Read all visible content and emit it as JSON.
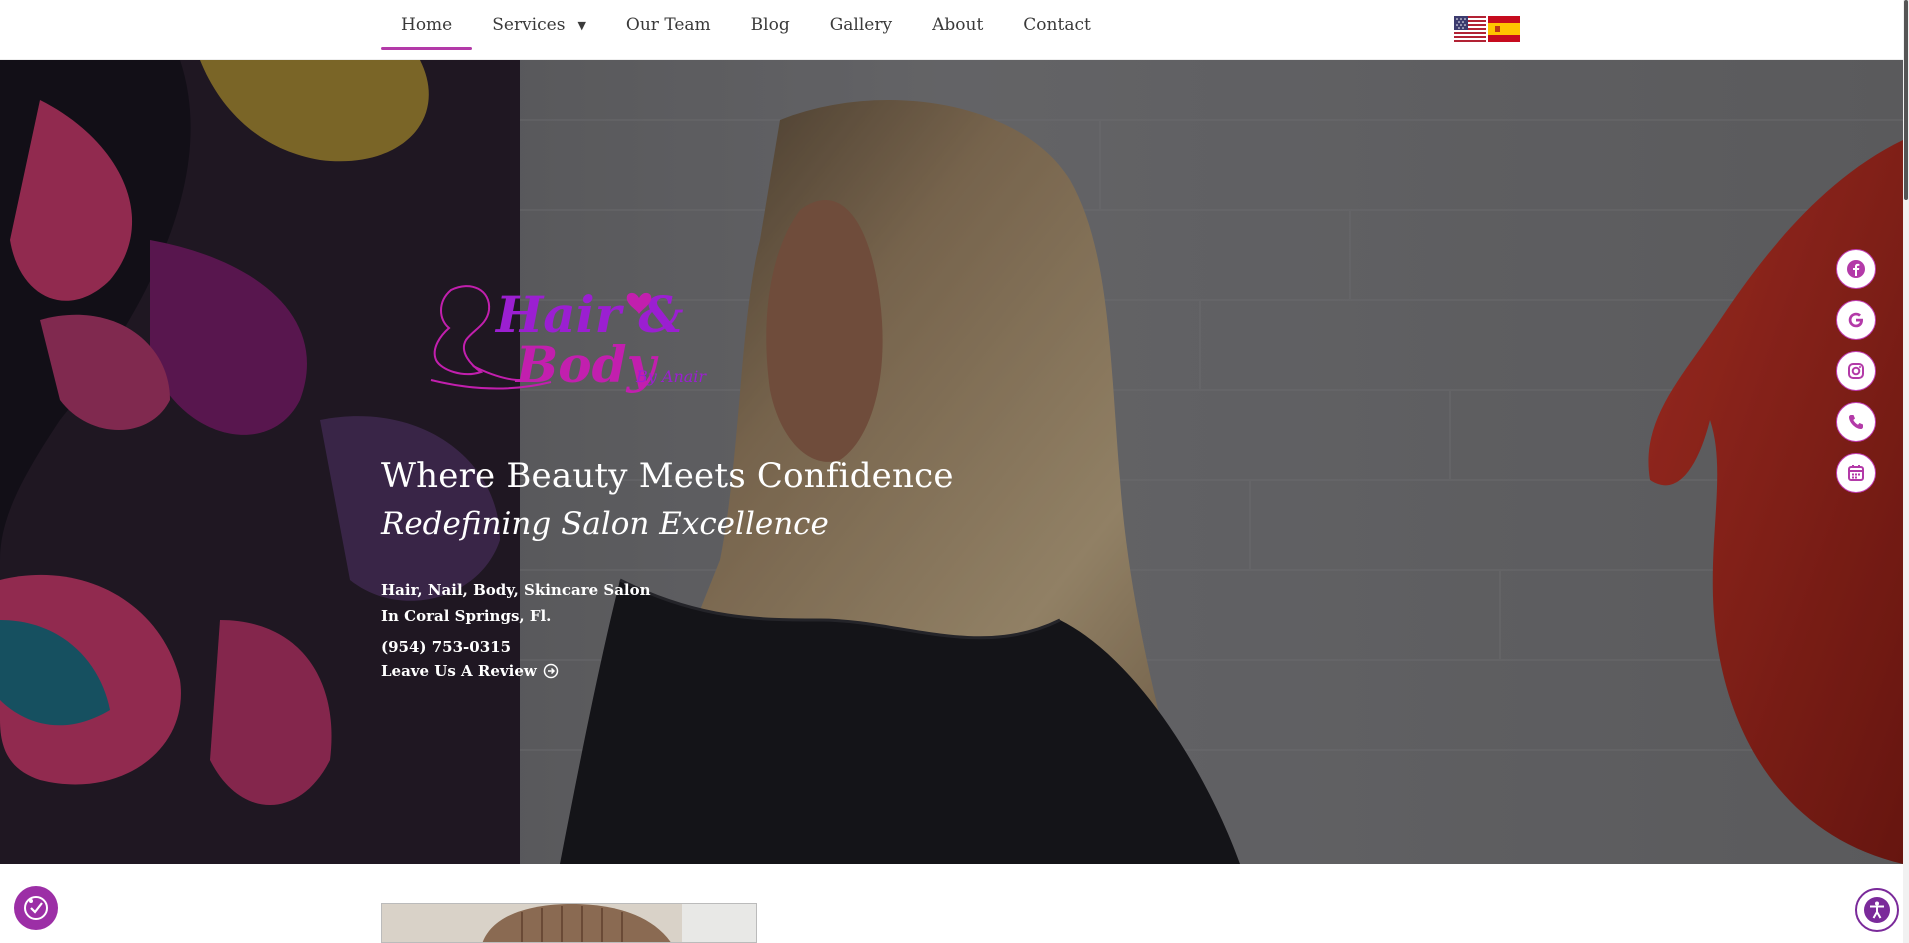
{
  "nav": {
    "items": [
      {
        "label": "Home",
        "active": true
      },
      {
        "label": "Services",
        "has_dropdown": true
      },
      {
        "label": "Our Team"
      },
      {
        "label": "Blog"
      },
      {
        "label": "Gallery"
      },
      {
        "label": "About"
      },
      {
        "label": "Contact"
      }
    ],
    "dropdown_icon": "caret-down-icon",
    "languages": [
      {
        "icon": "us-flag-icon"
      },
      {
        "icon": "spain-flag-icon"
      }
    ]
  },
  "hero": {
    "logo": {
      "line1": "Hair &",
      "line2": "Body",
      "byline": "By Anair"
    },
    "headline": "Where Beauty Meets Confidence",
    "tagline": "Redefining Salon Excellence",
    "description_line1": "Hair, Nail, Body, Skincare Salon",
    "description_line2": "In Coral Springs, Fl.",
    "phone": "(954) 753-0315",
    "review_link": "Leave Us A Review",
    "review_icon": "arrow-circle-right-icon"
  },
  "social": [
    {
      "icon": "facebook-icon"
    },
    {
      "icon": "google-icon"
    },
    {
      "icon": "instagram-icon"
    },
    {
      "icon": "phone-icon"
    },
    {
      "icon": "calendar-icon"
    }
  ],
  "accessibility": {
    "left_icon": "accessibility-widget-icon",
    "right_icon": "accessibility-person-icon"
  },
  "colors": {
    "accent": "#b33aa8",
    "logo_purple": "#9b1fd1",
    "logo_magenta": "#c21fae",
    "hero_text": "#ffffff"
  }
}
